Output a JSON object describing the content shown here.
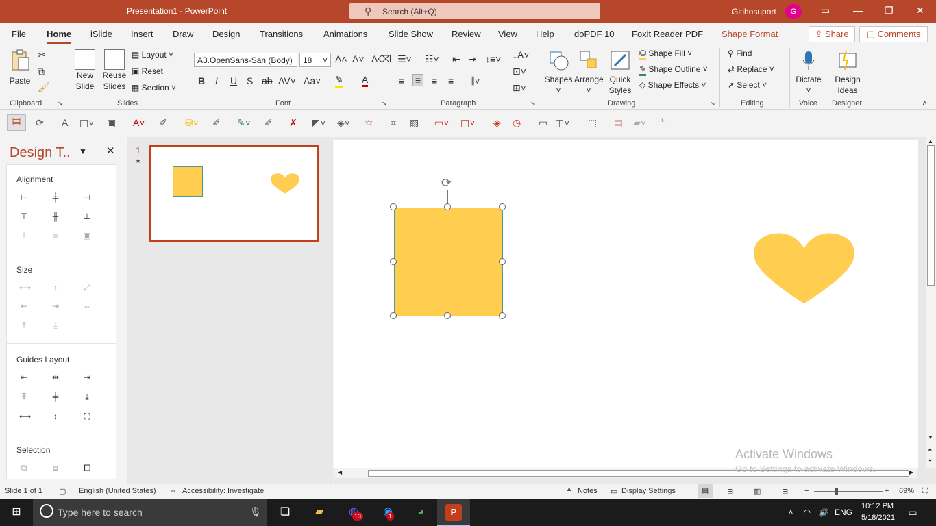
{
  "window": {
    "title": "Presentation1  -  PowerPoint",
    "search_placeholder": "Search (Alt+Q)",
    "user": "Gitihosuport",
    "avatar_initial": "G"
  },
  "tabs": [
    "File",
    "Home",
    "iSlide",
    "Insert",
    "Draw",
    "Design",
    "Transitions",
    "Animations",
    "Slide Show",
    "Review",
    "View",
    "Help",
    "doPDF 10",
    "Foxit Reader PDF",
    "Shape Format"
  ],
  "active_tab": "Home",
  "header_buttons": {
    "share": "Share",
    "comments": "Comments"
  },
  "ribbon": {
    "clipboard": {
      "label": "Clipboard",
      "paste": "Paste"
    },
    "slides": {
      "label": "Slides",
      "new_slide_1": "New",
      "new_slide_2": "Slide",
      "reuse_1": "Reuse",
      "reuse_2": "Slides",
      "layout": "Layout",
      "reset": "Reset",
      "section": "Section"
    },
    "font": {
      "label": "Font",
      "font_name": "A3.OpenSans-San (Body)",
      "font_size": "18"
    },
    "paragraph": {
      "label": "Paragraph"
    },
    "drawing": {
      "label": "Drawing",
      "shapes": "Shapes",
      "arrange": "Arrange",
      "quick_1": "Quick",
      "quick_2": "Styles",
      "shape_fill": "Shape Fill",
      "shape_outline": "Shape Outline",
      "shape_effects": "Shape Effects"
    },
    "editing": {
      "label": "Editing",
      "find": "Find",
      "replace": "Replace",
      "select": "Select"
    },
    "voice": {
      "label": "Voice",
      "dictate": "Dictate"
    },
    "designer": {
      "label": "Designer",
      "ideas_1": "Design",
      "ideas_2": "Ideas"
    }
  },
  "pane": {
    "title": "Design T..",
    "alignment": "Alignment",
    "size": "Size",
    "guides": "Guides Layout",
    "selection": "Selection"
  },
  "thumbnails": {
    "number": "1",
    "star": "★"
  },
  "watermark": {
    "line1": "Activate Windows",
    "line2": "Go to Settings to activate Windows."
  },
  "status": {
    "slide": "Slide 1 of 1",
    "language": "English (United States)",
    "accessibility": "Accessibility: Investigate",
    "notes": "Notes",
    "display": "Display Settings",
    "zoom": "69%"
  },
  "taskbar": {
    "search": "Type here to search",
    "lang": "ENG",
    "time": "10:12 PM",
    "date": "5/18/2021",
    "badge_viber": "13",
    "badge_zalo": "1"
  },
  "colors": {
    "accent": "#b7472a",
    "shape_fill": "#ffcd4f",
    "selection_outline": "#4a9e8f"
  }
}
